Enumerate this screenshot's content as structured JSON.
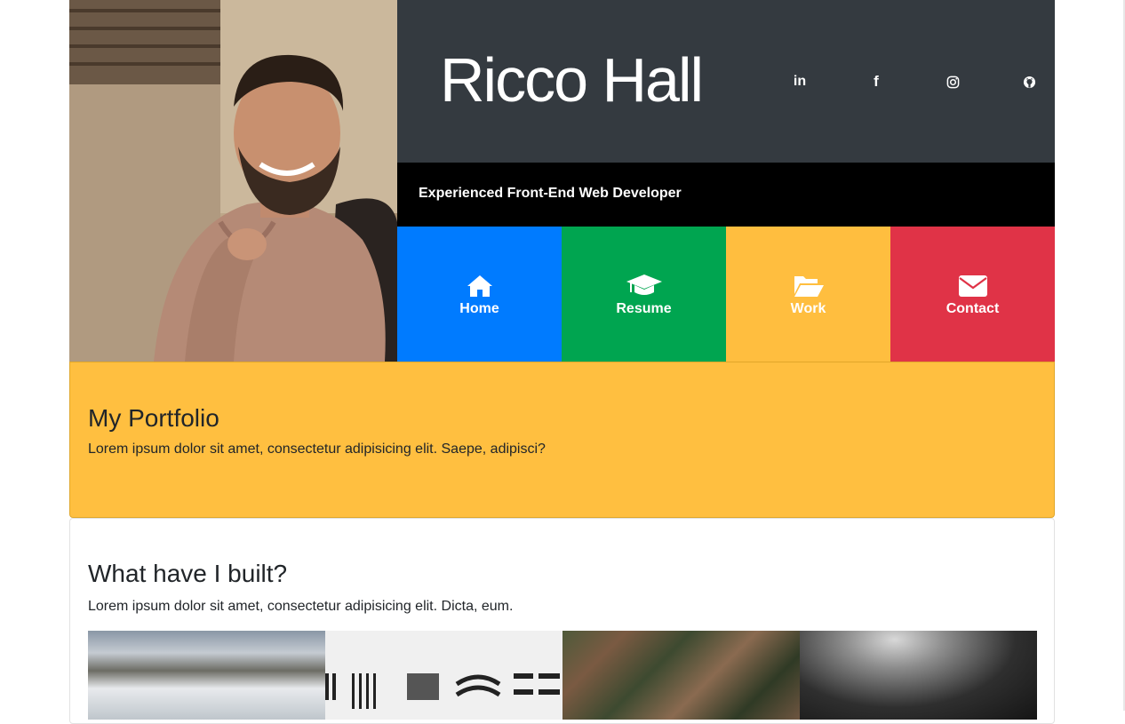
{
  "header": {
    "name": "Ricco Hall",
    "tagline": "Experienced Front-End Web Developer",
    "socials": [
      {
        "label": "in",
        "icon": "linkedin-icon"
      },
      {
        "label": "f",
        "icon": "facebook-icon"
      },
      {
        "label": "instagram",
        "icon": "instagram-icon"
      },
      {
        "label": "github",
        "icon": "github-icon"
      }
    ]
  },
  "nav": {
    "home": "Home",
    "resume": "Resume",
    "work": "Work",
    "contact": "Contact"
  },
  "portfolio": {
    "title": "My Portfolio",
    "text": "Lorem ipsum dolor sit amet, consectetur adipisicing elit. Saepe, adipisci?"
  },
  "built": {
    "title": "What have I built?",
    "text": "Lorem ipsum dolor sit amet, consectetur adipisicing elit. Dicta, eum."
  },
  "colors": {
    "header_dark": "#343a40",
    "home": "#007bff",
    "resume": "#00a550",
    "work": "#ffbe3f",
    "contact": "#e03347",
    "portfolio_bg": "#ffbf40"
  }
}
